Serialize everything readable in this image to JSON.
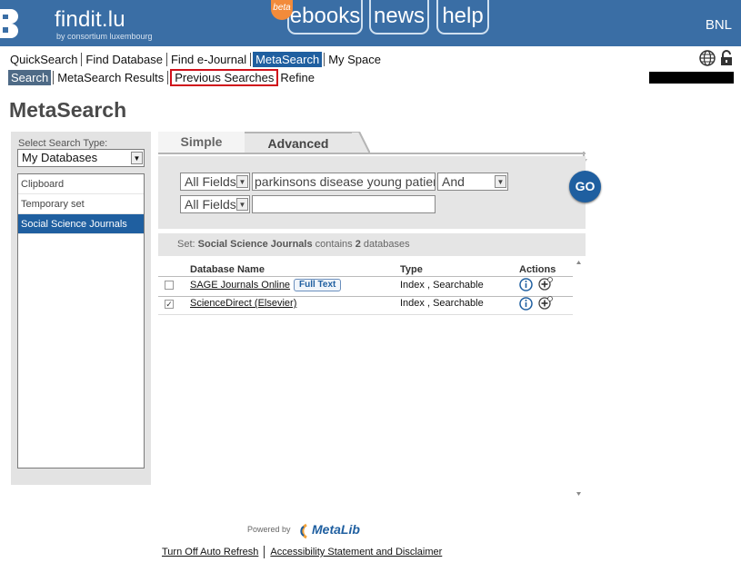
{
  "header": {
    "brand": "findit.lu",
    "brand_sub": "by consortium luxembourg",
    "beta": "beta",
    "nav": [
      "ebooks",
      "news",
      "help"
    ],
    "user": "BNL"
  },
  "main_tabs": [
    "QuickSearch",
    "Find Database",
    "Find e-Journal",
    "MetaSearch",
    "My Space"
  ],
  "main_tab_active": "MetaSearch",
  "sub_tabs": [
    "Search",
    "MetaSearch Results",
    "Previous Searches",
    "Refine"
  ],
  "sub_tab_active": "Search",
  "sub_tab_highlighted": "Previous Searches",
  "page_title": "MetaSearch",
  "left_panel": {
    "label": "Select Search Type:",
    "select_value": "My Databases",
    "items": [
      "Clipboard",
      "Temporary set",
      "Social Science Journals"
    ],
    "selected": "Social Science Journals"
  },
  "search_tabs": {
    "simple": "Simple",
    "advanced": "Advanced",
    "active": "Advanced"
  },
  "search": {
    "field1": "All Fields",
    "query1": "parkinsons disease young patients",
    "operator": "And",
    "field2": "All Fields",
    "query2": "",
    "go": "GO"
  },
  "set_info": {
    "prefix": "Set:",
    "name": "Social Science Journals",
    "middle": "contains",
    "count": "2",
    "suffix": "databases"
  },
  "results": {
    "headers": {
      "name": "Database Name",
      "type": "Type",
      "actions": "Actions"
    },
    "rows": [
      {
        "name": "SAGE Journals Online",
        "badge": "Full Text",
        "type": "Index , Searchable",
        "checked": false
      },
      {
        "name": "ScienceDirect (Elsevier)",
        "badge": "",
        "type": "Index , Searchable",
        "checked": true
      }
    ]
  },
  "footer": {
    "powered_by": "Powered by",
    "metalib": "MetaLib",
    "links": [
      "Turn Off Auto Refresh",
      "Accessibility Statement and Disclaimer"
    ]
  },
  "colors": {
    "header_bg": "#3a6ea5",
    "active_tab": "#1f5fa0",
    "highlight_border": "#d0111b",
    "beta_badge": "#f28b3b"
  }
}
